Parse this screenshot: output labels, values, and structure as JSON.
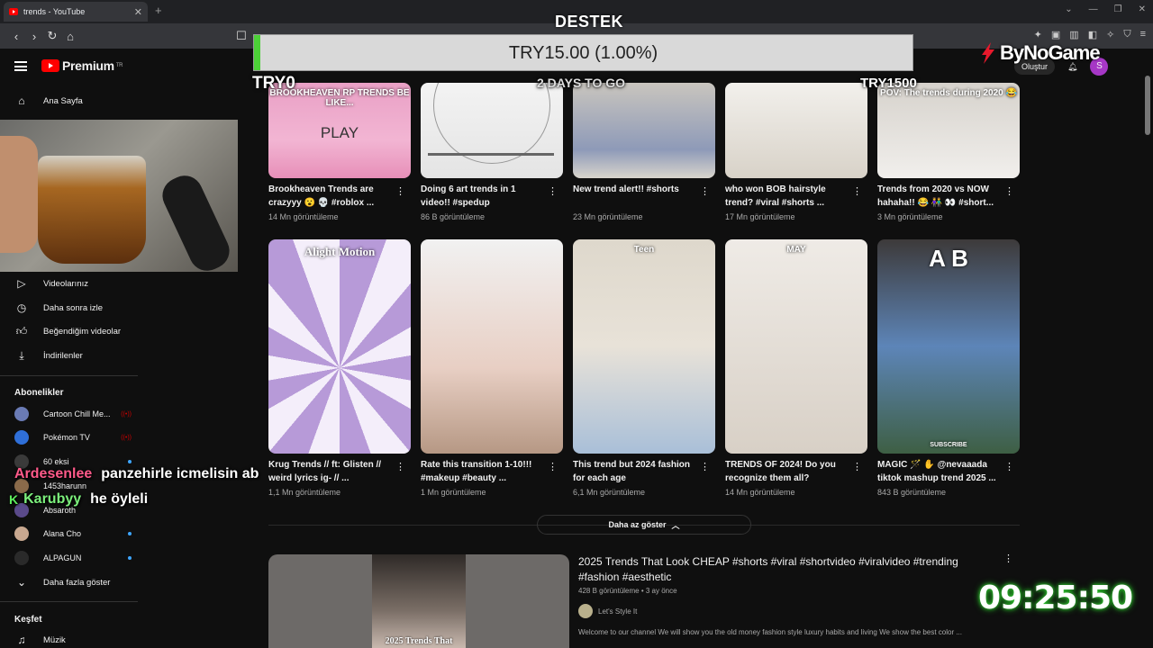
{
  "browser": {
    "tab_title": "trends - YouTube",
    "new_tab": "+",
    "nav": {
      "back": "‹",
      "forward": "›",
      "reload": "↻",
      "home": "⌂",
      "bookmark": "☐"
    }
  },
  "youtube": {
    "logo_text": "Premium",
    "logo_region": "TR",
    "create_label": "Oluştur",
    "avatar_letter": "S"
  },
  "sidebar": {
    "home": "Ana Sayfa",
    "items": [
      {
        "label": "Videolarınız",
        "icon": "video-icon"
      },
      {
        "label": "Daha sonra izle",
        "icon": "clock-icon"
      },
      {
        "label": "Beğendiğim videolar",
        "icon": "thumb-up-icon"
      },
      {
        "label": "İndirilenler",
        "icon": "download-icon"
      }
    ],
    "subs_heading": "Abonelikler",
    "subscriptions": [
      {
        "name": "Cartoon Chill Me...",
        "color": "#6a7bb5",
        "status": "live"
      },
      {
        "name": "Pokémon TV",
        "color": "#2f6fd8",
        "status": "live"
      },
      {
        "name": "60 eksi",
        "color": "#3a3a3a",
        "status": "dot"
      },
      {
        "name": "1453harunn",
        "color": "#8a6a4a",
        "status": "none"
      },
      {
        "name": "Absaroth",
        "color": "#5a4a8a",
        "status": "none"
      },
      {
        "name": "Alana Cho",
        "color": "#c8a890",
        "status": "dot"
      },
      {
        "name": "ALPAGUN",
        "color": "#2a2a2a",
        "status": "dot"
      }
    ],
    "show_more": "Daha fazla göster",
    "explore_heading": "Keşfet",
    "music": "Müzik"
  },
  "videos": [
    {
      "title": "Brookheaven Trends are crazyyy 😮 💀 #roblox ...",
      "views": "14 Mn görüntüleme",
      "overlay": "BROOKHEAVEN RP TRENDS BE LIKE...",
      "overlay2": "PLAY"
    },
    {
      "title": "Doing 6 art trends in 1 video!! #spedup",
      "views": "86 B görüntüleme"
    },
    {
      "title": "New trend alert!! #shorts",
      "views": "23 Mn görüntüleme"
    },
    {
      "title": "who won BOB hairstyle trend? #viral #shorts ...",
      "views": "17 Mn görüntüleme"
    },
    {
      "title": "Trends from 2020 vs NOW hahaha!! 😂 👫 👀 #short...",
      "views": "3 Mn görüntüleme",
      "overlay": "POV: The trends during 2020 😂"
    },
    {
      "title": "Krug Trends // ft: Glisten // weird lyrics ig- // ...",
      "views": "1,1 Mn görüntüleme",
      "overlay": "Alight Motion"
    },
    {
      "title": "Rate this transition 1-10!!! #makeup #beauty ...",
      "views": "1 Mn görüntüleme"
    },
    {
      "title": "This trend but 2024 fashion for each age",
      "views": "6,1 Mn görüntüleme",
      "overlay": "Teen"
    },
    {
      "title": "TRENDS OF 2024! Do you recognize them all?",
      "views": "14 Mn görüntüleme",
      "overlay": "MAY"
    },
    {
      "title": "MAGIC 🪄 ✋ @nevaaada tiktok mashup trend 2025 ...",
      "views": "843 B görüntüleme",
      "overlay": "A      B",
      "overlay2": "SUBSCRIBE"
    }
  ],
  "show_less": "Daha az göster",
  "long_video": {
    "title": "2025 Trends That Look CHEAP #shorts #viral #shortvideo #viralvideo #trending #fashion #aesthetic",
    "meta": "428 B görüntüleme • 3 ay önce",
    "channel": "Let's Style It",
    "description": "Welcome to our channel We will show you the old money fashion style luxury habits and living We show the best color ...",
    "thumb_caption": "2025 Trends That"
  },
  "stream": {
    "destek": "DESTEK",
    "donation_text": "TRY15.00 (1.00%)",
    "donation_progress": 0.01,
    "donation_min": "TRY0",
    "donation_max": "TRY1500",
    "days_left": "2 DAYS TO GO",
    "sponsor": "ByNoGame",
    "timer": "09:25:50",
    "chat": [
      {
        "user": "Ardesenlee",
        "message": "panzehirle icmelisin ab",
        "user_color": "#ff5a8a",
        "badge": ""
      },
      {
        "user": "Karubyy",
        "message": "he öyleli",
        "user_color": "#7cf07c",
        "badge": "K"
      }
    ]
  },
  "colors": {
    "accent": "#ff0000",
    "bg": "#0f0f0f",
    "progress": "#4cd137",
    "timer_glow": "#33cc33"
  }
}
